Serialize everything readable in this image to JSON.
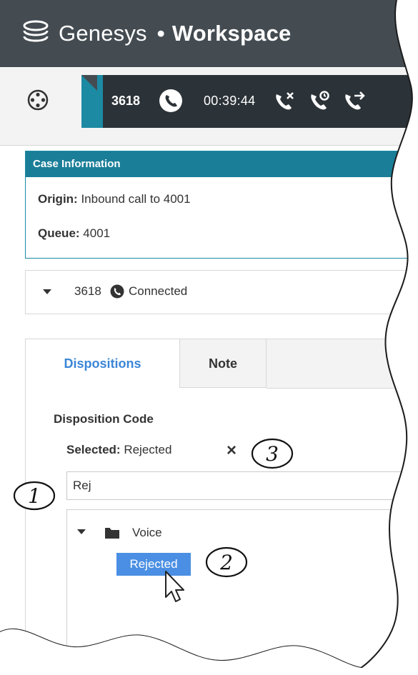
{
  "header": {
    "brand": "Genesys",
    "separator": "•",
    "product": "Workspace"
  },
  "toolbar": {
    "menu_icon": "hub-menu-icon",
    "call": {
      "number": "3618",
      "timer": "00:39:44",
      "icons": [
        "phone-icon",
        "end-call-icon",
        "hold-call-icon",
        "transfer-call-icon"
      ]
    }
  },
  "case_info": {
    "title": "Case Information",
    "origin_label": "Origin:",
    "origin_value": "Inbound call to 4001",
    "queue_label": "Queue:",
    "queue_value": "4001"
  },
  "connection": {
    "number": "3618",
    "status": "Connected"
  },
  "tabs": [
    {
      "label": "Dispositions",
      "active": true
    },
    {
      "label": "Note",
      "active": false
    }
  ],
  "disposition": {
    "title": "Disposition Code",
    "selected_label": "Selected:",
    "selected_value": "Rejected",
    "clear_icon": "×",
    "search_value": "Rej",
    "tree": {
      "folder": "Voice",
      "selected_item": "Rejected"
    }
  },
  "callouts": [
    "1",
    "2",
    "3"
  ],
  "colors": {
    "header_bg": "#444c52",
    "accent_teal": "#1a7e98",
    "tab_active": "#3b86d6",
    "selection_blue": "#4a8fe3"
  }
}
